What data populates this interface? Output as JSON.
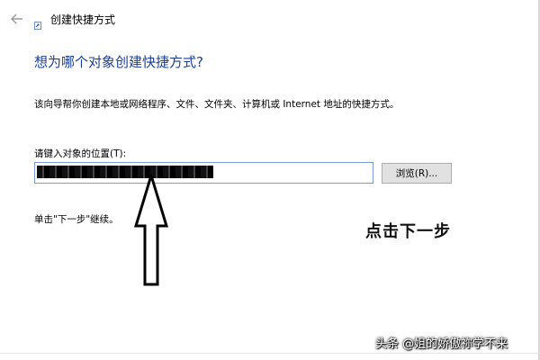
{
  "window": {
    "title": "创建快捷方式"
  },
  "header": {
    "back_icon": "back-arrow-icon",
    "wizard_icon": "shortcut-wizard-icon"
  },
  "main": {
    "heading": "想为哪个对象创建快捷方式?",
    "description": "该向导帮你创建本地或网络程序、文件、文件夹、计算机或 Internet 地址的快捷方式。",
    "location_label": "请键入对象的位置(T):",
    "location_value": "",
    "browse_label": "浏览(R)...",
    "continue_hint": "单击\"下一步\"继续。"
  },
  "annotation": {
    "text": "点击下一步",
    "arrow_icon": "up-arrow-annotation-icon"
  },
  "watermark": {
    "text": "头条 @姐的娇傲祢学不来"
  },
  "colors": {
    "heading": "#1a3e9a",
    "input_border": "#7a9cd3",
    "button_bg": "#e1e1e1"
  }
}
